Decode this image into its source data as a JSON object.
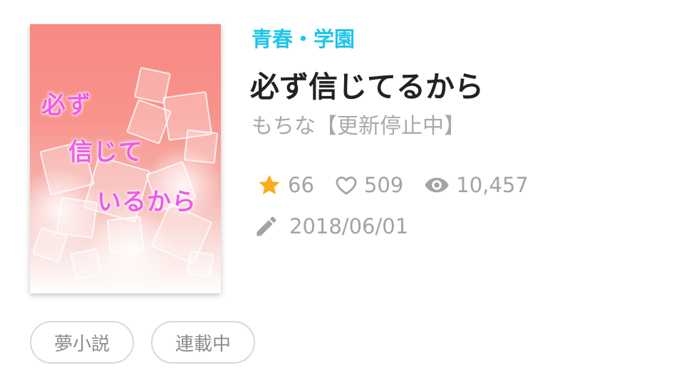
{
  "book": {
    "cover_lines": [
      "必ず",
      "信じて",
      "いるから"
    ],
    "genre": "青春・学園",
    "title": "必ず信じてるから",
    "author": "もちな【更新停止中】",
    "stats": {
      "stars": "66",
      "likes": "509",
      "views": "10,457"
    },
    "updated": "2018/06/01"
  },
  "tags": [
    "夢小説",
    "連載中"
  ],
  "colors": {
    "genre": "#1fc5e8",
    "star": "#f9ad1c",
    "muted": "#a3a3a3",
    "cover_text": "#ee5ce8"
  },
  "icons": {
    "stars": "star-icon",
    "likes": "heart-icon",
    "views": "eye-icon",
    "updated": "pencil-icon"
  }
}
